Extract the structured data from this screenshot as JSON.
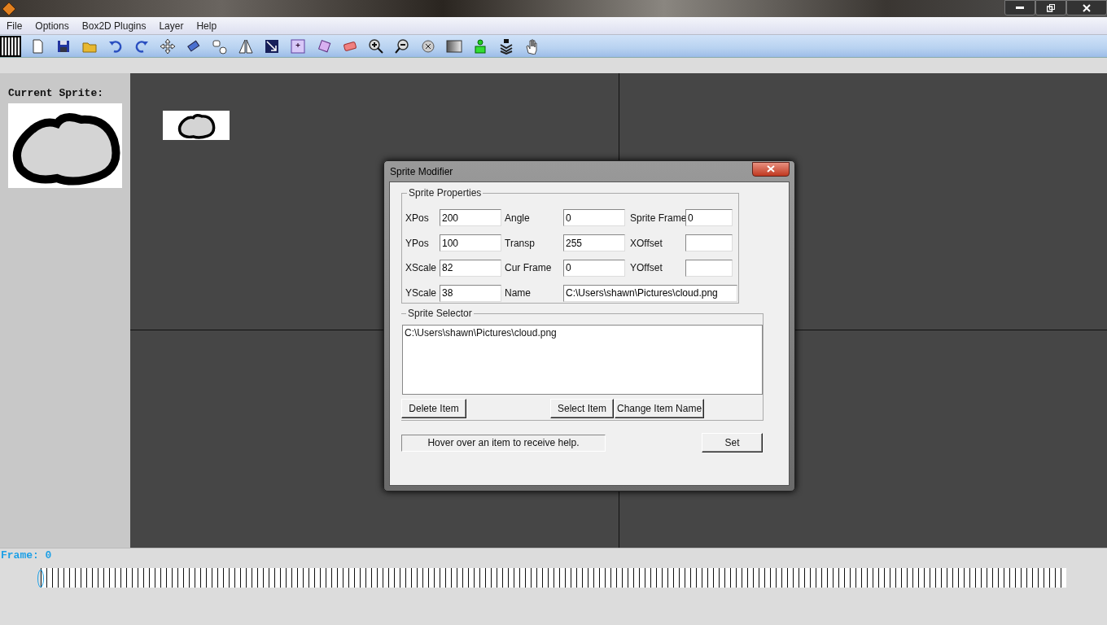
{
  "menu": [
    "File",
    "Options",
    "Box2D Plugins",
    "Layer",
    "Help"
  ],
  "current_sprite": {
    "label": "Current Sprite:"
  },
  "dialog": {
    "title": "Sprite Modifier",
    "properties": {
      "legend": "Sprite Properties",
      "fields": [
        {
          "label": "XPos",
          "value": "200"
        },
        {
          "label": "Angle",
          "value": "0"
        },
        {
          "label": "Sprite Frame",
          "value": "0"
        },
        {
          "label": "YPos",
          "value": "100"
        },
        {
          "label": "Transp",
          "value": "255"
        },
        {
          "label": "XOffset"
        },
        {
          "label": "XScale",
          "value": "82"
        },
        {
          "label": "Cur Frame",
          "value": "0"
        },
        {
          "label": "YOffset"
        },
        {
          "label": "YScale",
          "value": "38"
        },
        {
          "label": "Name",
          "value": "C:\\Users\\shawn\\Pictures\\cloud.png"
        }
      ]
    },
    "selector": {
      "legend": "Sprite Selector",
      "items": [
        "C:\\Users\\shawn\\Pictures\\cloud.png"
      ],
      "buttons": [
        "Delete Item",
        "Select Item",
        "Change Item Name"
      ]
    },
    "help": "Hover over an item to receive help.",
    "set_button": "Set"
  },
  "frame": {
    "label": "Frame: 0",
    "level": 0
  }
}
